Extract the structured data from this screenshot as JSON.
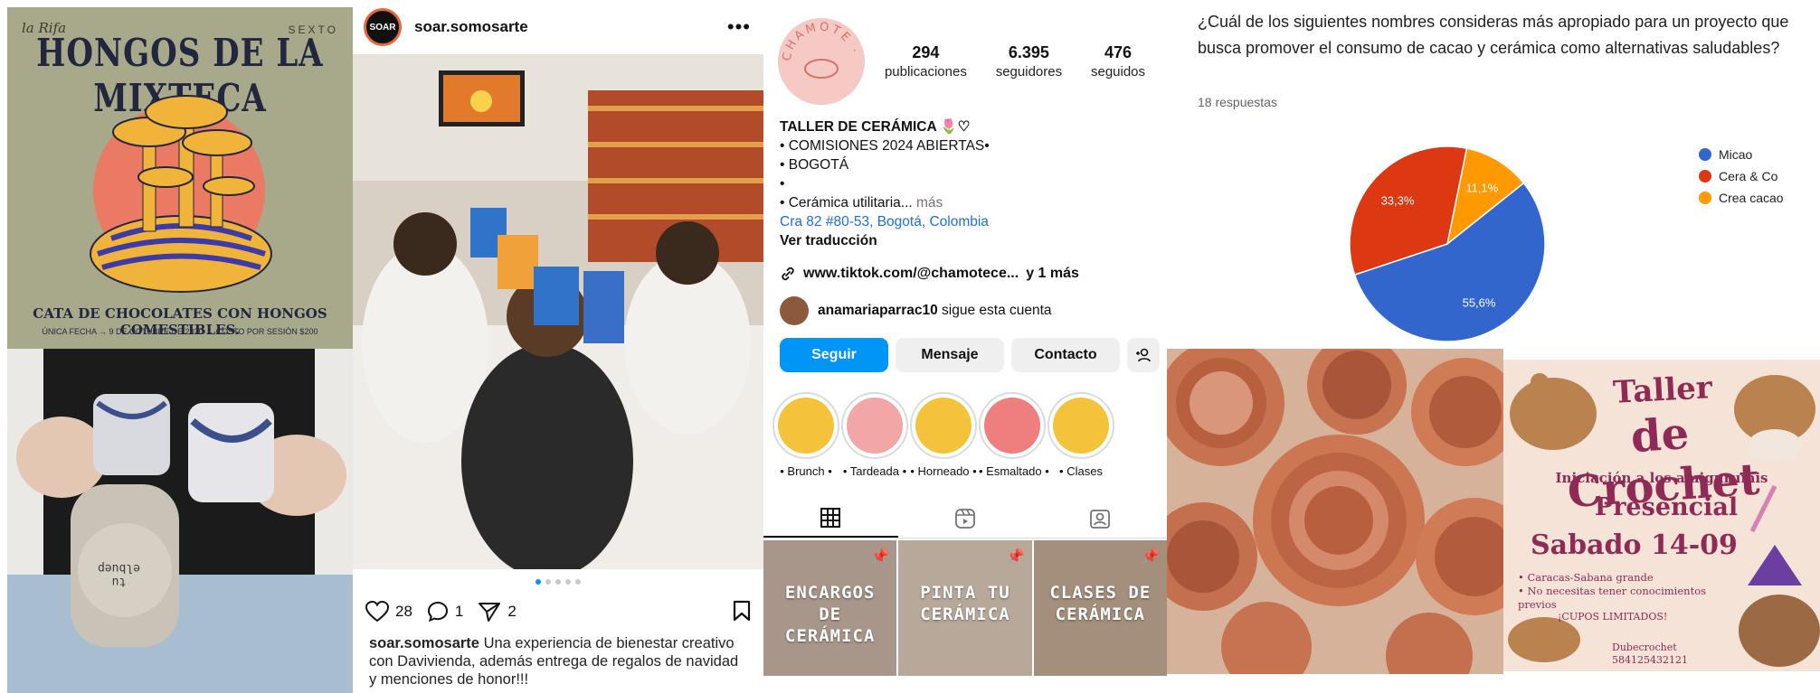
{
  "hongos_poster": {
    "brand": "la Rifa",
    "series": "SEXTO",
    "title": "HONGOS DE LA MIXTECA",
    "subtitle": "CATA DE CHOCOLATES CON HONGOS COMESTIBLES.",
    "details": "ÚNICA FECHA → 9 DE OCTUBRE DE 2020 → COSTO POR SESIÓN $200",
    "colors": {
      "background": "#a8a98a",
      "sun": "#ea7a63",
      "ink": "#23263f",
      "mushroom": "#f0b43a"
    }
  },
  "mug_photo": {
    "mug_text": "tu\nelbuep"
  },
  "soar_post": {
    "avatar_text": "SOAR",
    "username": "soar.somosarte",
    "more_icon": "more-dots-icon",
    "likes": "28",
    "comments": "1",
    "shares": "2",
    "caption_user": "soar.somosarte",
    "caption_text": "Una experiencia de bienestar creativo con Davivienda, además entrega de regalos de navidad y menciones de honor!!!",
    "carousel_dots": 5,
    "carousel_active": 0
  },
  "chamote_profile": {
    "logo_text": "CHAMOTE · CERÁMICA",
    "stats": [
      {
        "number": "294",
        "label": "publicaciones"
      },
      {
        "number": "6.395",
        "label": "seguidores"
      },
      {
        "number": "476",
        "label": "seguidos"
      }
    ],
    "bio": {
      "name": "TALLER DE CERÁMICA 🌷♡",
      "line1": "• COMISIONES 2024 ABIERTAS•",
      "line2": "• BOGOTÁ",
      "line3": "•",
      "line4": "• Cerámica utilitaria...",
      "more": "más",
      "location": "Cra 82 #80-53, Bogotá, Colombia",
      "translate": "Ver traducción"
    },
    "link": "www.tiktok.com/@chamotece...",
    "link_more": "y 1 más",
    "follower_user": "anamariaparrac10",
    "follower_text": "sigue esta cuenta",
    "buttons": {
      "follow": "Seguir",
      "message": "Mensaje",
      "contact": "Contacto"
    },
    "highlights": [
      {
        "label": "• Brunch •",
        "color": "#f5c33b"
      },
      {
        "label": "• Tardeada •",
        "color": "#f2a6a6"
      },
      {
        "label": "• Horneado •",
        "color": "#f5c33b"
      },
      {
        "label": "• Esmaltado •",
        "color": "#ef7e7e"
      },
      {
        "label": "• Clases",
        "color": "#f5c33b"
      }
    ],
    "grid_posts": [
      {
        "text": "ENCARGOS DE CERÁMICA"
      },
      {
        "text": "PINTA TU CERÁMICA"
      },
      {
        "text": "CLASES DE CERÁMICA"
      }
    ]
  },
  "survey": {
    "question": "¿Cuál de los siguientes nombres consideras más apropiado para un proyecto que busca promover el consumo de cacao y cerámica como alternativas saludables?",
    "responses": "18 respuestas",
    "chart_data": {
      "type": "pie",
      "title": "",
      "categories": [
        "Micao",
        "Cera & Co",
        "Crea cacao"
      ],
      "values": [
        55.6,
        33.3,
        11.1
      ],
      "labels": [
        "55,6%",
        "33,3%",
        "11,1%"
      ],
      "colors": [
        "#3366cc",
        "#dc3912",
        "#ff9900"
      ],
      "legend_position": "right"
    }
  },
  "crochet_poster": {
    "title1": "Taller",
    "title2": "de Crochet",
    "subtitle": "Iniciación a los amigurumis",
    "mode": "Presencial",
    "date": "Sabado 14-09",
    "bullets": [
      "Caracas-Sabana grande",
      "No necesitas tener conocimientos previos"
    ],
    "cupos": "¡CUPOS LIMITADOS!",
    "handle": "Dubecrochet",
    "phone": "584125432121",
    "color": "#8e2a55"
  }
}
